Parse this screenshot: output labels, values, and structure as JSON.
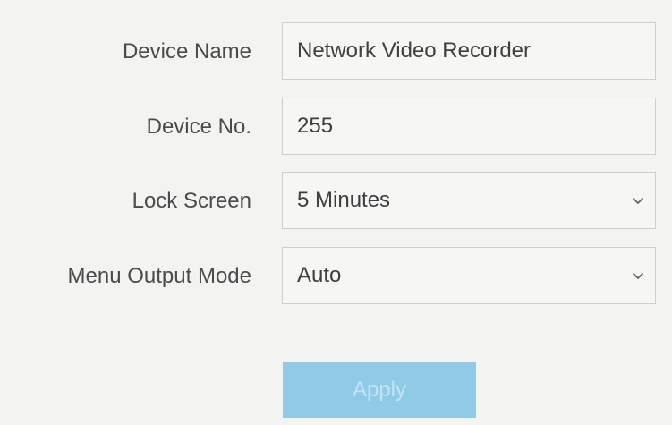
{
  "form": {
    "device_name": {
      "label": "Device Name",
      "value": "Network Video Recorder"
    },
    "device_no": {
      "label": "Device No.",
      "value": "255"
    },
    "lock_screen": {
      "label": "Lock Screen",
      "value": "5 Minutes",
      "icon": "chevron-down-icon"
    },
    "menu_output_mode": {
      "label": "Menu Output Mode",
      "value": "Auto",
      "icon": "chevron-down-icon"
    },
    "apply_label": "Apply"
  },
  "colors": {
    "background": "#f3f3f1",
    "field_border": "#cfcfcd",
    "apply_button_disabled": "#8fcae7"
  }
}
